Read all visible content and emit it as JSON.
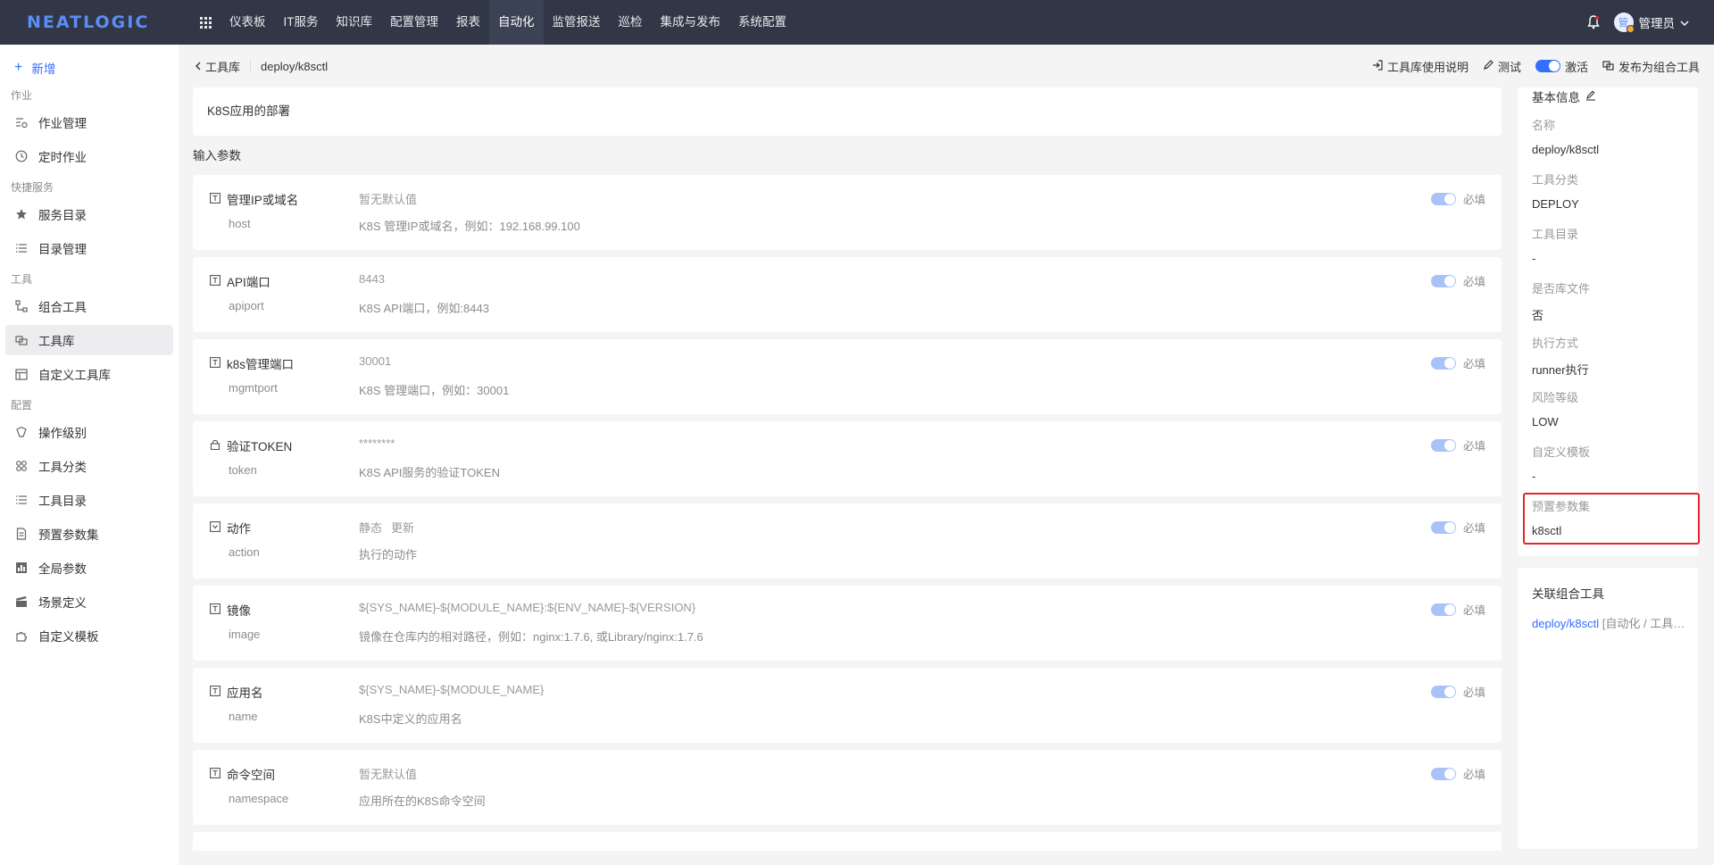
{
  "brand": {
    "logo_text": "NEATLOGIC",
    "accent": "#336eff",
    "topbar_bg": "#313747",
    "highlight": "#e3262d"
  },
  "topnav": {
    "items": [
      {
        "label": "仪表板"
      },
      {
        "label": "IT服务"
      },
      {
        "label": "知识库"
      },
      {
        "label": "配置管理"
      },
      {
        "label": "报表"
      },
      {
        "label": "自动化"
      },
      {
        "label": "监管报送"
      },
      {
        "label": "巡检"
      },
      {
        "label": "集成与发布"
      },
      {
        "label": "系统配置"
      }
    ],
    "active": "自动化",
    "user": {
      "avatar_text": "管",
      "name": "管理员"
    },
    "icons": [
      "apps-grid-icon",
      "bell-icon",
      "chevron-down-icon"
    ]
  },
  "sidebar": {
    "add_label": "新增",
    "groups": [
      {
        "title": "作业",
        "items": [
          {
            "label": "作业管理",
            "icon": "job-list-icon"
          },
          {
            "label": "定时作业",
            "icon": "clock-icon"
          }
        ]
      },
      {
        "title": "快捷服务",
        "items": [
          {
            "label": "服务目录",
            "icon": "star-icon"
          },
          {
            "label": "目录管理",
            "icon": "list-icon"
          }
        ]
      },
      {
        "title": "工具",
        "items": [
          {
            "label": "组合工具",
            "icon": "flow-icon"
          },
          {
            "label": "工具库",
            "icon": "library-icon",
            "active": true
          },
          {
            "label": "自定义工具库",
            "icon": "calendar-icon"
          }
        ]
      },
      {
        "title": "配置",
        "items": [
          {
            "label": "操作级别",
            "icon": "badge-icon"
          },
          {
            "label": "工具分类",
            "icon": "category-icon"
          },
          {
            "label": "工具目录",
            "icon": "list-icon"
          },
          {
            "label": "预置参数集",
            "icon": "document-icon"
          },
          {
            "label": "全局参数",
            "icon": "chart-icon"
          },
          {
            "label": "场景定义",
            "icon": "clapper-icon"
          },
          {
            "label": "自定义模板",
            "icon": "puzzle-icon"
          }
        ]
      }
    ]
  },
  "breadcrumb": {
    "parent": "工具库",
    "current": "deploy/k8sctl"
  },
  "actions": {
    "manual": "工具库使用说明",
    "test": "测试",
    "activate": "激活",
    "publish": "发布为组合工具"
  },
  "description": "K8S应用的部署",
  "input_params_title": "输入参数",
  "required_label": "必填",
  "params": [
    {
      "icon": "text-icon",
      "name": "管理IP或域名",
      "key": "host",
      "default": "暂无默认值",
      "desc": "K8S 管理IP或域名，例如：192.168.99.100"
    },
    {
      "icon": "text-icon",
      "name": "API端口",
      "key": "apiport",
      "default": "8443",
      "desc": "K8S API端口，例如:8443"
    },
    {
      "icon": "text-icon",
      "name": "k8s管理端口",
      "key": "mgmtport",
      "default": "30001",
      "desc": "K8S 管理端口，例如：30001"
    },
    {
      "icon": "lock-icon",
      "name": "验证TOKEN",
      "key": "token",
      "default": "********",
      "desc": "K8S API服务的验证TOKEN"
    },
    {
      "icon": "select-icon",
      "name": "动作",
      "key": "action",
      "options": [
        "静态",
        "更新"
      ],
      "desc": "执行的动作"
    },
    {
      "icon": "text-icon",
      "name": "镜像",
      "key": "image",
      "default": "${SYS_NAME}-${MODULE_NAME}:${ENV_NAME}-${VERSION}",
      "desc": "镜像在仓库内的相对路径，例如：nginx:1.7.6, 或Library/nginx:1.7.6"
    },
    {
      "icon": "text-icon",
      "name": "应用名",
      "key": "name",
      "default": "${SYS_NAME}-${MODULE_NAME}",
      "desc": "K8S中定义的应用名"
    },
    {
      "icon": "text-icon",
      "name": "命令空间",
      "key": "namespace",
      "default": "暂无默认值",
      "desc": "应用所在的K8S命令空间"
    }
  ],
  "basic_info": {
    "title": "基本信息",
    "fields": [
      {
        "label": "名称",
        "value": "deploy/k8sctl"
      },
      {
        "label": "工具分类",
        "value": "DEPLOY"
      },
      {
        "label": "工具目录",
        "value": "-"
      },
      {
        "label": "是否库文件",
        "value": "否"
      },
      {
        "label": "执行方式",
        "value": "runner执行"
      },
      {
        "label": "风险等级",
        "value": "LOW"
      },
      {
        "label": "自定义模板",
        "value": "-"
      },
      {
        "label": "预置参数集",
        "value": "k8sctl"
      }
    ]
  },
  "related": {
    "title": "关联组合工具",
    "link": "deploy/k8sctl",
    "path": "[自动化 / 工具…"
  }
}
